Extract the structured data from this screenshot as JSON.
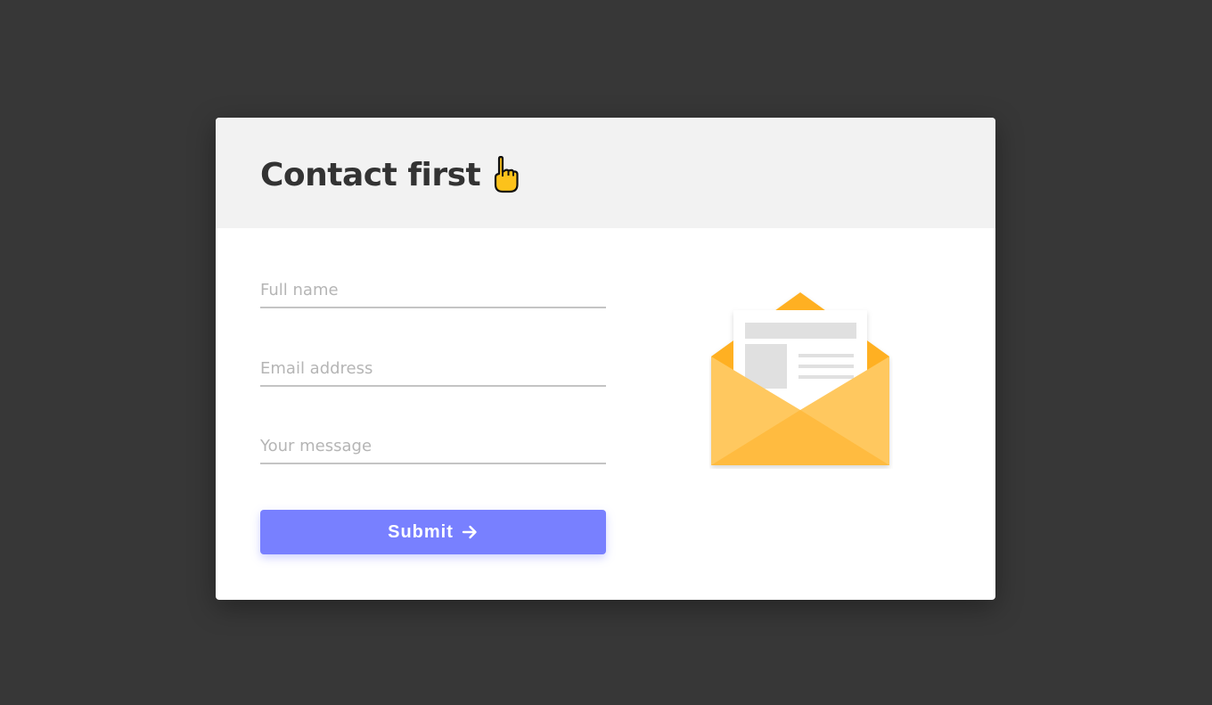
{
  "header": {
    "title": "Contact first"
  },
  "form": {
    "full_name": {
      "placeholder": "Full name",
      "value": ""
    },
    "email": {
      "placeholder": "Email address",
      "value": ""
    },
    "message": {
      "placeholder": "Your message",
      "value": ""
    },
    "submit_label": "Submit"
  },
  "icons": {
    "title_icon": "pointing-up-hand-icon",
    "submit_icon": "arrow-right-icon",
    "illustration": "open-envelope-illustration"
  },
  "colors": {
    "background": "#373737",
    "card": "#ffffff",
    "header": "#f2f2f2",
    "accent": "#7880ff",
    "envelope": "#ffc558"
  }
}
